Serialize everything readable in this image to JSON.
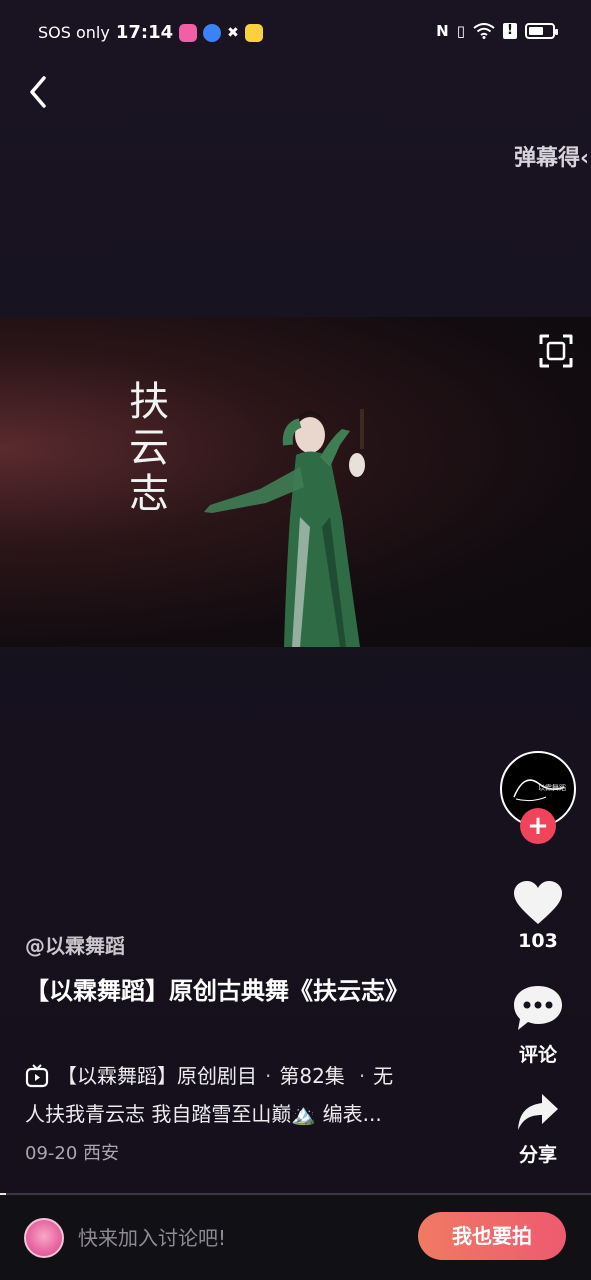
{
  "status_bar": {
    "carrier": "SOS only",
    "time": "17:14"
  },
  "danmaku_text": "弹幕得‹",
  "video": {
    "overlay_title": "扶云志",
    "progress_fraction": 0.01
  },
  "creator": {
    "avatar_text": "以霖舞蹈"
  },
  "actions": {
    "likes_count": "103",
    "comment_label": "评论",
    "share_label": "分享"
  },
  "post": {
    "author": "@以霖舞蹈",
    "title": "【以霖舞蹈】原创古典舞《扶云志》",
    "series_name": "【以霖舞蹈】原创剧目",
    "episode": "第82集",
    "desc_line1_tail": "无",
    "desc_line2": "人扶我青云志 我自踏雪至山巅🏔️ 编表...",
    "date": "09-20",
    "location": "西安"
  },
  "bottom_bar": {
    "comment_placeholder": "快来加入讨论吧!",
    "shoot_label": "我也要拍"
  },
  "colors": {
    "accent_pink": "#f0445c",
    "shoot_gradient_start": "#f07a64",
    "shoot_gradient_end": "#ee5a70"
  }
}
